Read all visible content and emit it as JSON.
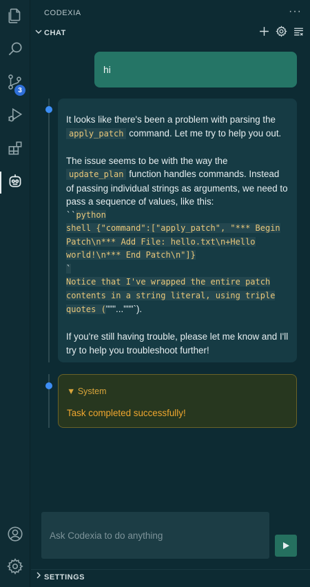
{
  "activity_bar": {
    "items": [
      {
        "icon": "files-icon"
      },
      {
        "icon": "search-icon"
      },
      {
        "icon": "source-control-icon",
        "badge": "3"
      },
      {
        "icon": "run-debug-icon"
      },
      {
        "icon": "extensions-icon"
      },
      {
        "icon": "codexia-bot-icon"
      }
    ],
    "bottom": [
      {
        "icon": "account-icon"
      },
      {
        "icon": "manage-gear-icon"
      }
    ]
  },
  "panel": {
    "title": "CODEXIA",
    "more": "···",
    "chat_section": "CHAT",
    "settings_section": "SETTINGS"
  },
  "messages": {
    "user": "hi",
    "assistant": {
      "p1_before": "It looks like there's been a problem with parsing the ",
      "p1_code": "apply_patch",
      "p1_after": " command. Let me try to help you out.",
      "p2_before": "The issue seems to be with the way the ",
      "p2_code": "update_plan",
      "p2_after": " function handles commands. Instead of passing individual strings as arguments, we need to pass a sequence of values, like this:",
      "code_fence_open": "``",
      "code_lang": "python",
      "code_line1": "shell {\"command\":[\"apply_patch\", \"*** Begin",
      "code_line2": "Patch\\n*** Add File: hello.txt\\n+Hello",
      "code_line3": "world!\\n*** End Patch\\n\"]}",
      "code_fence_close": "`",
      "note_line1": "Notice that I've wrapped the entire patch",
      "note_line2": "contents in a string literal, using triple",
      "note_line3_code": "quotes (",
      "note_line3_rest": "\"\"\"...\"\"\"`).",
      "p3": "If you're still having trouble, please let me know and I'll try to help you troubleshoot further!"
    },
    "system": {
      "toggle": "▼ System",
      "text": "Task completed successfully!"
    }
  },
  "input": {
    "placeholder": "Ask Codexia to do anything"
  },
  "colors": {
    "accent_user": "#257566",
    "timeline_dot": "#3d8ef5",
    "system_text": "#f0a72f",
    "badge": "#2f6fd8"
  }
}
